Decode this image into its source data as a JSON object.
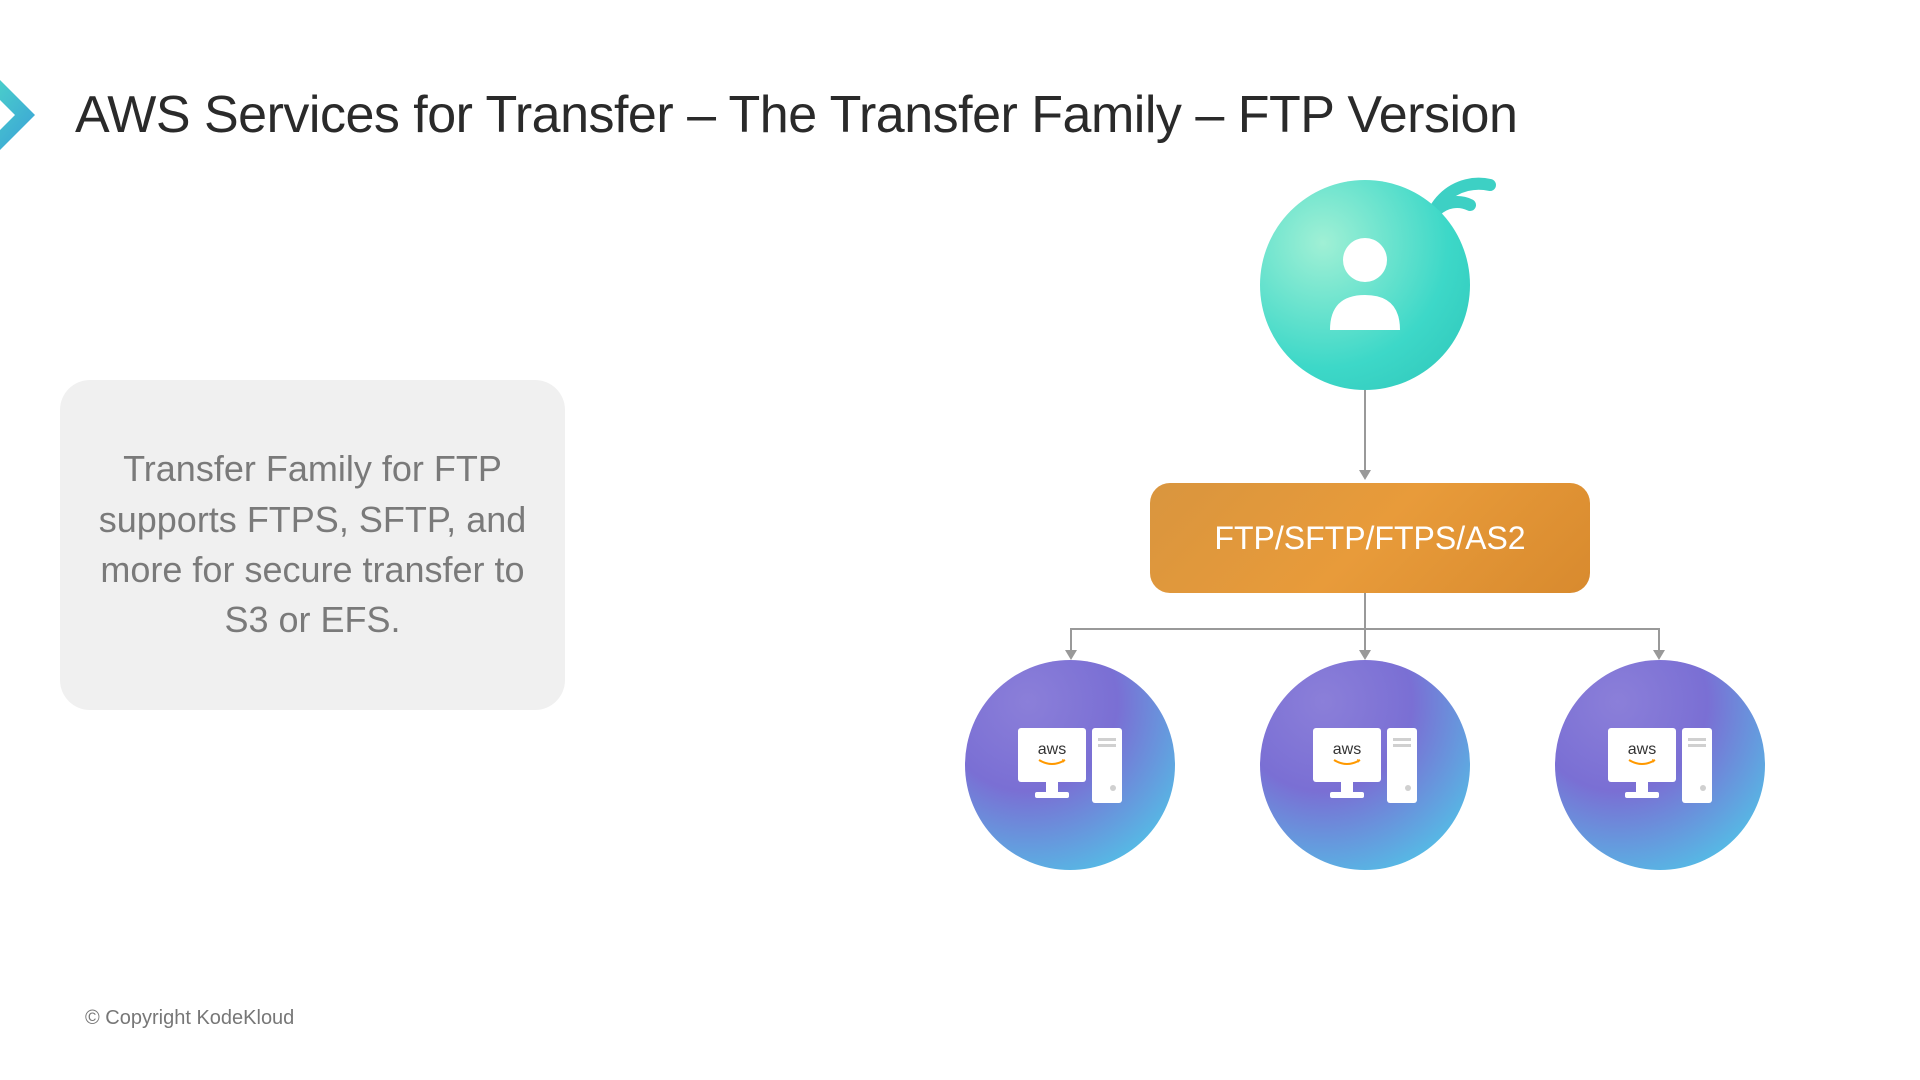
{
  "title": "AWS Services for Transfer – The Transfer Family – FTP Version",
  "info_text": "Transfer Family for FTP supports FTPS, SFTP, and more for secure transfer to S3 or EFS.",
  "protocol_label": "FTP/SFTP/FTPS/AS2",
  "server_label": "aws",
  "copyright": "© Copyright KodeKloud",
  "colors": {
    "teal": "#3dd8c8",
    "orange": "#e89b3a",
    "purple_blue": "#7a6fd4"
  }
}
